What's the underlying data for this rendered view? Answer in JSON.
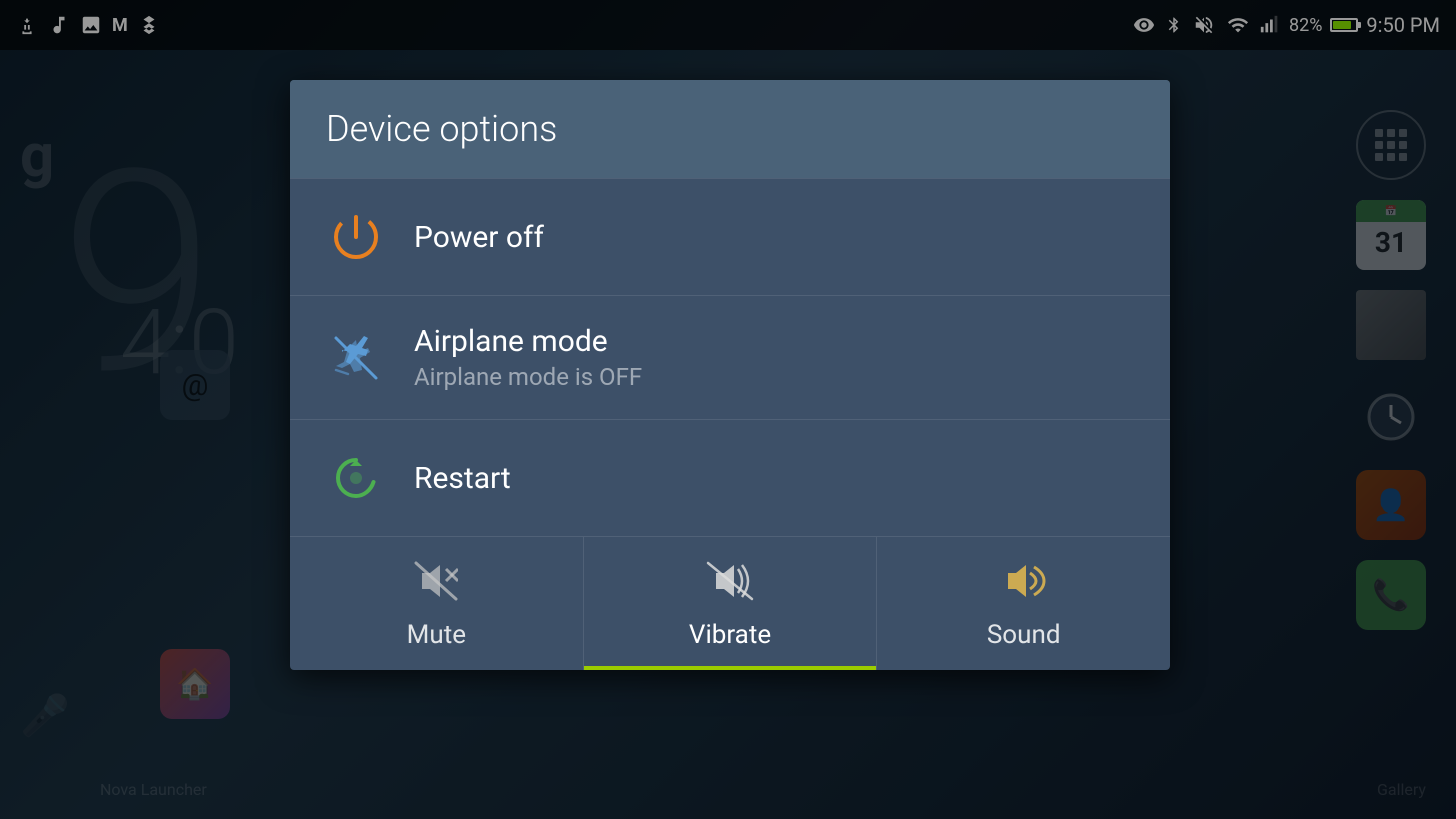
{
  "statusBar": {
    "time": "9:50 PM",
    "battery": "82%",
    "icons": [
      "usb-icon",
      "music-icon",
      "image-icon",
      "gmail-icon",
      "dropbox-icon",
      "eye-icon",
      "bluetooth-icon",
      "mute-icon",
      "wifi-icon",
      "signal-icon"
    ]
  },
  "desktop": {
    "bigNumber": "9",
    "googleLetter": "g",
    "timeDisplay": "4:0",
    "novaLabel": "Nova Launcher",
    "galleryLabel": "Gallery"
  },
  "dialog": {
    "title": "Device options",
    "items": [
      {
        "id": "power-off",
        "label": "Power off",
        "sublabel": "",
        "iconType": "power"
      },
      {
        "id": "airplane-mode",
        "label": "Airplane mode",
        "sublabel": "Airplane mode is OFF",
        "iconType": "airplane"
      },
      {
        "id": "restart",
        "label": "Restart",
        "sublabel": "",
        "iconType": "restart"
      }
    ],
    "soundControls": [
      {
        "id": "mute",
        "label": "Mute",
        "iconType": "mute",
        "active": false
      },
      {
        "id": "vibrate",
        "label": "Vibrate",
        "iconType": "vibrate",
        "active": true
      },
      {
        "id": "sound",
        "label": "Sound",
        "iconType": "sound",
        "active": false
      }
    ]
  },
  "calendar": {
    "day": "31"
  }
}
